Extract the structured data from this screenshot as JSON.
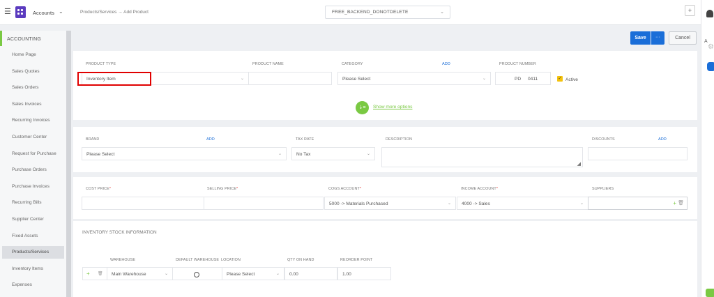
{
  "header": {
    "app_name": "Accounts",
    "breadcrumb": "Products/Services → Add Product",
    "tenant": "FREE_BACKEND_DONOTDELETE",
    "plus": "+"
  },
  "right_strip": {
    "letter": "A"
  },
  "sidebar": {
    "section": "ACCOUNTING",
    "items": [
      "Home Page",
      "Sales Quotes",
      "Sales Orders",
      "Sales Invoices",
      "Recurring Invoices",
      "Customer Center",
      "Request for Purchase",
      "Purchase Orders",
      "Purchase Invoices",
      "Recurring Bills",
      "Supplier Center",
      "Fixed Assets",
      "Products/Services",
      "Inventory Items",
      "Expenses"
    ],
    "active": "Products/Services"
  },
  "actions": {
    "save": "Save",
    "more": "···",
    "cancel": "Cancel"
  },
  "product": {
    "type_label": "PRODUCT TYPE",
    "type_value": "Inventory Item",
    "name_label": "PRODUCT NAME",
    "name_value": "",
    "category_label": "CATEGORY",
    "category_add": "ADD",
    "category_value": "Please Select",
    "number_label": "PRODUCT NUMBER",
    "number_prefix": "PD",
    "number_value": "0411",
    "active_label": "Active",
    "show_more": "Show more options"
  },
  "details": {
    "brand_label": "BRAND",
    "brand_add": "ADD",
    "brand_value": "Please Select",
    "tax_label": "TAX RATE",
    "tax_value": "No Tax",
    "desc_label": "DESCRIPTION",
    "discounts_label": "DISCOUNTS",
    "discounts_add": "ADD"
  },
  "pricing": {
    "cost_label": "COST PRICE",
    "selling_label": "SELLING PRICE",
    "cogs_label": "COGS ACCOUNT",
    "cogs_value": "5000 -> Materials Purchased",
    "income_label": "INCOME ACCOUNT",
    "income_value": "4000 -> Sales",
    "suppliers_label": "SUPPLIERS",
    "required_mark": "*"
  },
  "inventory": {
    "title": "INVENTORY STOCK INFORMATION",
    "col_warehouse": "WAREHOUSE",
    "col_default": "DEFAULT WAREHOUSE",
    "col_location": "LOCATION",
    "col_qty": "QTY ON HAND",
    "col_reorder": "REORDER POINT",
    "row": {
      "warehouse": "Main Warehouse",
      "location": "Please Select",
      "qty": "0.00",
      "reorder": "1.00"
    }
  },
  "colors": {
    "accent_blue": "#1a6ed8",
    "accent_green": "#7ac943",
    "highlight_red": "#e00000",
    "brand_purple": "#5b3bbf"
  }
}
